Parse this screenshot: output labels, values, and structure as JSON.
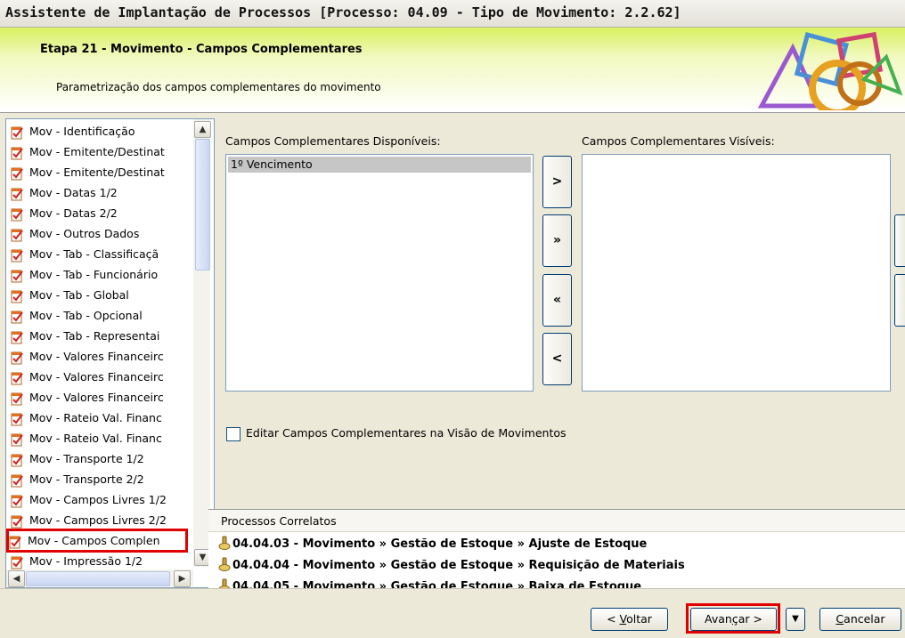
{
  "window": {
    "title": "Assistente de Implantação de Processos [Processo: 04.09 - Tipo de Movimento: 2.2.62]"
  },
  "banner": {
    "step_title": "Etapa 21 - Movimento - Campos Complementares",
    "step_description": "Parametrização dos campos complementares do movimento"
  },
  "steps": [
    "Mov - Identificação",
    "Mov - Emitente/Destinat",
    "Mov - Emitente/Destinat",
    "Mov - Datas 1/2",
    "Mov - Datas 2/2",
    "Mov - Outros Dados",
    "Mov - Tab - Classificaçã",
    "Mov - Tab - Funcionário",
    "Mov - Tab - Global",
    "Mov - Tab - Opcional",
    "Mov - Tab - Representai",
    "Mov - Valores Financeirc",
    "Mov - Valores Financeirc",
    "Mov - Valores Financeirc",
    "Mov - Rateio Val. Financ",
    "Mov - Rateio Val. Financ",
    "Mov - Transporte 1/2",
    "Mov - Transporte 2/2",
    "Mov - Campos Livres 1/2",
    "Mov - Campos Livres 2/2",
    "Mov - Campos Complen",
    "Mov - Impressão 1/2"
  ],
  "selected_step_index": 20,
  "fields": {
    "available_label": "Campos Complementares Disponíveis:",
    "available_items": [
      "1º Vencimento"
    ],
    "visible_label": "Campos Complementares Visíveis:",
    "move_buttons": [
      ">",
      "»",
      "«",
      "<"
    ],
    "edit_checkbox_label": "Editar Campos Complementares na Visão de Movimentos",
    "edit_checkbox_checked": false
  },
  "related": {
    "header": "Processos Correlatos",
    "items": [
      "04.04.03 - Movimento » Gestão de Estoque » Ajuste de Estoque",
      "04.04.04 - Movimento » Gestão de Estoque » Requisição de Materiais",
      "04.04.05 - Movimento » Gestão de Estoque » Baixa de Estoque"
    ]
  },
  "footer": {
    "back": {
      "pre": "< ",
      "key": "V",
      "post": "oltar"
    },
    "next": {
      "pre": "Avan",
      "key": "ç",
      "post": "ar >"
    },
    "cancel": {
      "pre": "",
      "key": "C",
      "post": "ancelar"
    }
  },
  "colors": {
    "highlight_red": "#e00000",
    "banner_green": "#d8f060"
  }
}
